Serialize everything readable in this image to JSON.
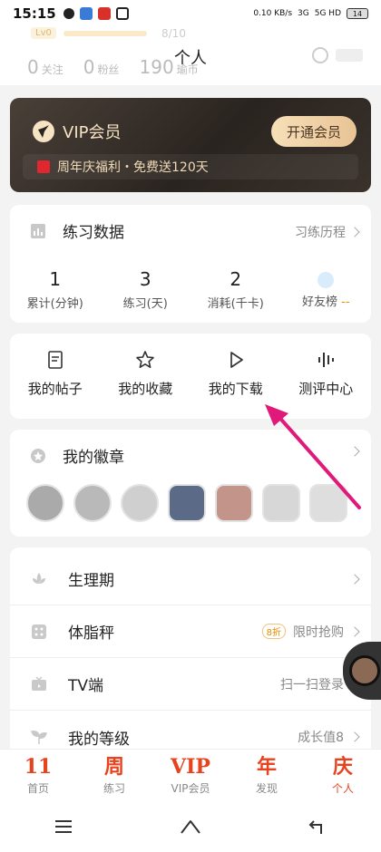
{
  "status_bar": {
    "time": "15:15",
    "speed": "0.10 KB/s",
    "net1": "3G",
    "net2": "5G HD",
    "battery": "14"
  },
  "profile": {
    "level": "Lv0",
    "level_progress": "8/10",
    "title": "个人",
    "stats": [
      {
        "value": "0",
        "label": "关注"
      },
      {
        "value": "0",
        "label": "粉丝"
      },
      {
        "value": "190",
        "label": "瑜币"
      }
    ]
  },
  "vip": {
    "title": "VIP会员",
    "button": "开通会员",
    "promo": "周年庆福利・免费送120天"
  },
  "practice": {
    "title": "练习数据",
    "link": "习练历程",
    "metrics": [
      {
        "value": "1",
        "label": "累计(分钟)"
      },
      {
        "value": "3",
        "label": "练习(天)"
      },
      {
        "value": "2",
        "label": "消耗(千卡)"
      }
    ],
    "friends_label": "好友榜",
    "friends_value": "--"
  },
  "quick": [
    {
      "label": "我的帖子",
      "icon": "document-icon"
    },
    {
      "label": "我的收藏",
      "icon": "star-icon"
    },
    {
      "label": "我的下载",
      "icon": "play-icon"
    },
    {
      "label": "测评中心",
      "icon": "waveform-icon"
    }
  ],
  "badges": {
    "title": "我的徽章"
  },
  "list": [
    {
      "label": "生理期",
      "right": "",
      "pill": ""
    },
    {
      "label": "体脂秤",
      "right": "限时抢购",
      "pill": "8折"
    },
    {
      "label": "TV端",
      "right": "扫一扫登录",
      "pill": ""
    },
    {
      "label": "我的等级",
      "right": "成长值8",
      "pill": ""
    }
  ],
  "tabs": [
    {
      "glyph": "11",
      "label": "首页"
    },
    {
      "glyph": "周",
      "label": "练习"
    },
    {
      "glyph": "VIP",
      "label": "VIP会员"
    },
    {
      "glyph": "年",
      "label": "发现"
    },
    {
      "glyph": "庆",
      "label": "个人"
    }
  ],
  "colors": {
    "accent": "#e8431f",
    "vip_bg": "#2a2420",
    "vip_gold": "#f6e3c3",
    "arrow": "#e0197a"
  }
}
